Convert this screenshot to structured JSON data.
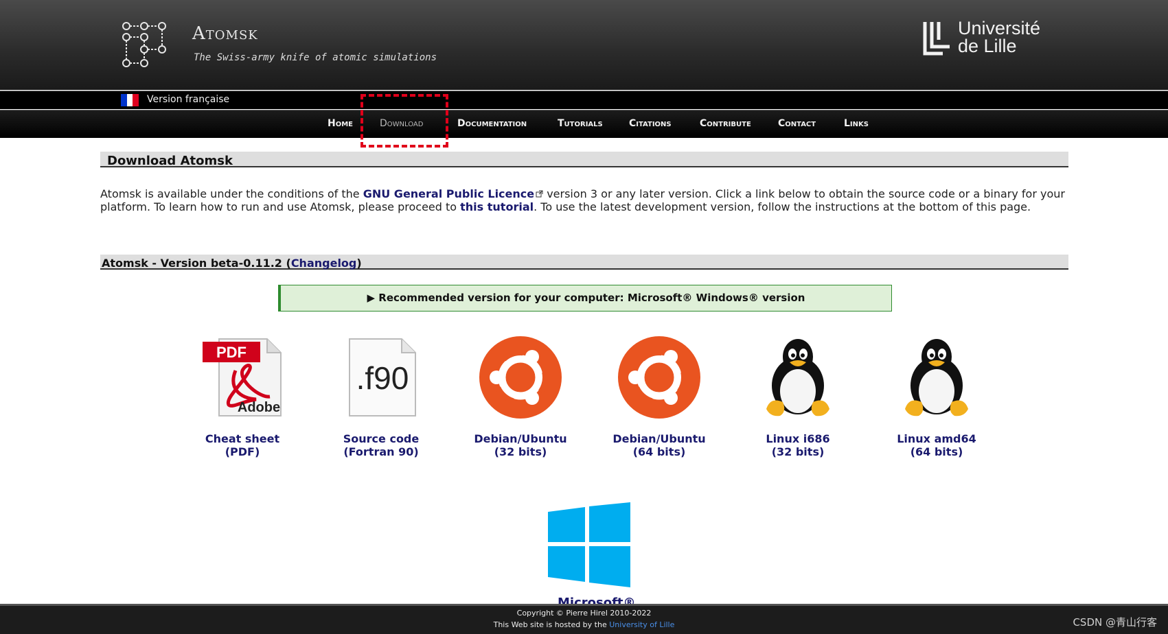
{
  "header": {
    "site_title": "Atomsk",
    "tagline": "The Swiss-army knife of atomic simulations",
    "university": {
      "line1": "Université",
      "line2": "de Lille"
    }
  },
  "langbar": {
    "label": "Version française"
  },
  "nav": {
    "items": [
      "Home",
      "Download",
      "Documentation",
      "Tutorials",
      "Citations",
      "Contribute",
      "Contact",
      "Links"
    ],
    "active": "Download"
  },
  "page": {
    "title": "Download Atomsk",
    "intro_part1": "Atomsk is available under the conditions of the ",
    "intro_link1": "GNU General Public Licence",
    "intro_part2": " version 3 or any later version. Click a link below to obtain the source code or a binary for your platform. To learn how to run and use Atomsk, please proceed to ",
    "intro_link2": "this tutorial",
    "intro_part3": ". To use the latest development version, follow the instructions at the bottom of this page."
  },
  "version": {
    "label": "Atomsk - Version beta-0.11.2 (",
    "changelog": "Changelog",
    "close": ")"
  },
  "recommendation": "▶ Recommended version for your computer: Microsoft® Windows® version",
  "downloads": [
    {
      "line1": "Cheat sheet",
      "line2": "(PDF)",
      "icon": "pdf-icon"
    },
    {
      "line1": "Source code",
      "line2": "(Fortran 90)",
      "icon": "f90-file-icon"
    },
    {
      "line1": "Debian/Ubuntu",
      "line2": "(32 bits)",
      "icon": "ubuntu-icon"
    },
    {
      "line1": "Debian/Ubuntu",
      "line2": "(64 bits)",
      "icon": "ubuntu-icon"
    },
    {
      "line1": "Linux i686",
      "line2": "(32 bits)",
      "icon": "tux-icon"
    },
    {
      "line1": "Linux amd64",
      "line2": "(64 bits)",
      "icon": "tux-icon"
    }
  ],
  "windows_label_partial": "Microsoft®",
  "icon_text": {
    "pdf": "PDF",
    "adobe": "Adobe",
    "f90": ".f90"
  },
  "footer": {
    "copyright": "Copyright © Pierre Hirel 2010-2022",
    "hosted_prefix": "This Web site is hosted by the ",
    "hosted_link": "University of Lille"
  },
  "watermark": "CSDN @青山行客",
  "colors": {
    "nav_bg": "#000000",
    "link": "#1a1a6e",
    "reco_bg": "#dff0d8",
    "reco_border": "#2e8b2e",
    "ubuntu": "#e95420",
    "windows": "#00adef",
    "highlight": "#e0001a"
  }
}
